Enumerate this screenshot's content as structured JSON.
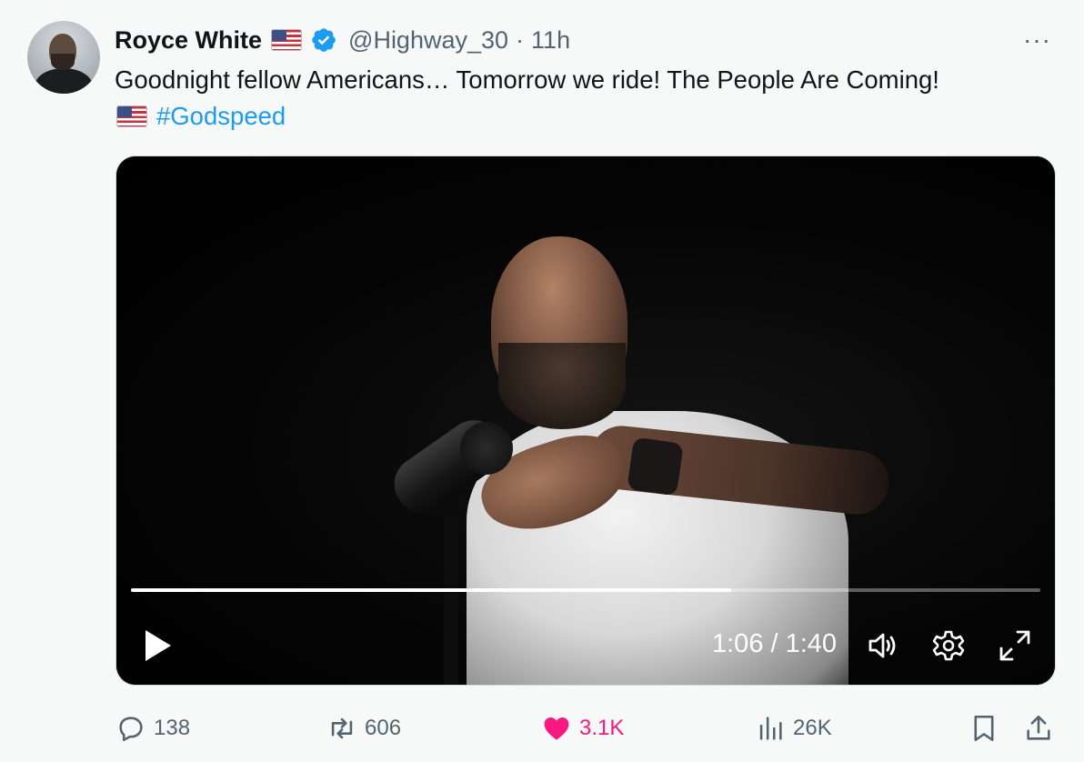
{
  "user": {
    "name": "Royce White",
    "handle": "@Highway_30",
    "separator": "·",
    "time": "11h",
    "name_flag_icon": "us-flag-icon",
    "verified_icon": "verified-badge-icon"
  },
  "more_menu": {
    "icon": "more-dots-icon",
    "label": "···"
  },
  "tweet": {
    "text": "Goodnight fellow Americans… Tomorrow we ride! The People Are Coming!",
    "line2_flag_icon": "us-flag-icon",
    "hashtag": "#Godspeed"
  },
  "video": {
    "current_time": "1:06",
    "duration": "1:40",
    "timecode": "1:06 / 1:40",
    "progress_fraction": 0.66,
    "controls": [
      "play-icon",
      "volume-icon",
      "settings-icon",
      "fullscreen-icon"
    ]
  },
  "actions": {
    "replies": "138",
    "reposts": "606",
    "likes": "3.1K",
    "views": "26K"
  },
  "colors": {
    "link": "#1d9bf0",
    "like": "#f91880",
    "muted": "#536471",
    "text": "#0f1419"
  }
}
